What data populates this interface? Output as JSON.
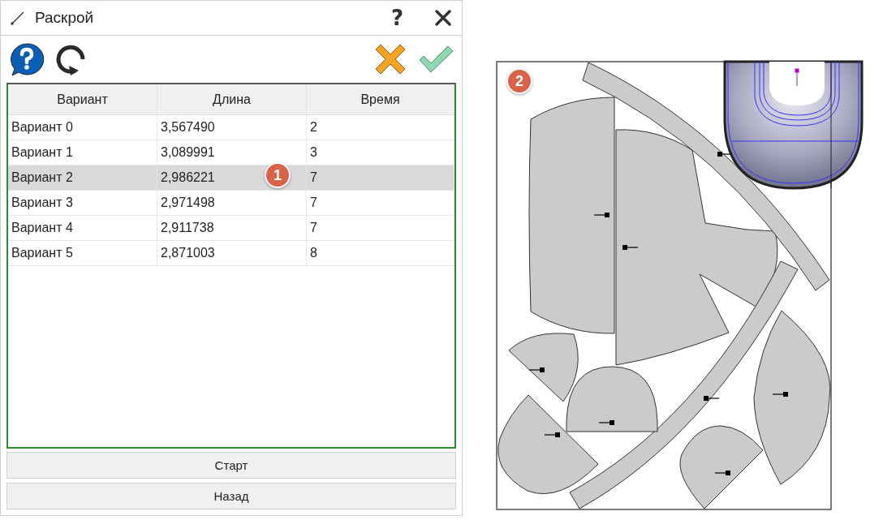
{
  "dialog": {
    "title": "Раскрой",
    "help_glyph": "?"
  },
  "table": {
    "columns": [
      "Вариант",
      "Длина",
      "Время"
    ],
    "rows": [
      {
        "cells": [
          "Вариант 0",
          "3,567490",
          "2"
        ],
        "selected": false
      },
      {
        "cells": [
          "Вариант 1",
          "3,089991",
          "3"
        ],
        "selected": false
      },
      {
        "cells": [
          "Вариант 2",
          "2,986221",
          "7"
        ],
        "selected": true
      },
      {
        "cells": [
          "Вариант 3",
          "2,971498",
          "7"
        ],
        "selected": false
      },
      {
        "cells": [
          "Вариант 4",
          "2,911738",
          "7"
        ],
        "selected": false
      },
      {
        "cells": [
          "Вариант 5",
          "2,871003",
          "8"
        ],
        "selected": false
      }
    ]
  },
  "buttons": [
    "Старт",
    "Назад"
  ],
  "callouts": [
    "1",
    "2"
  ]
}
